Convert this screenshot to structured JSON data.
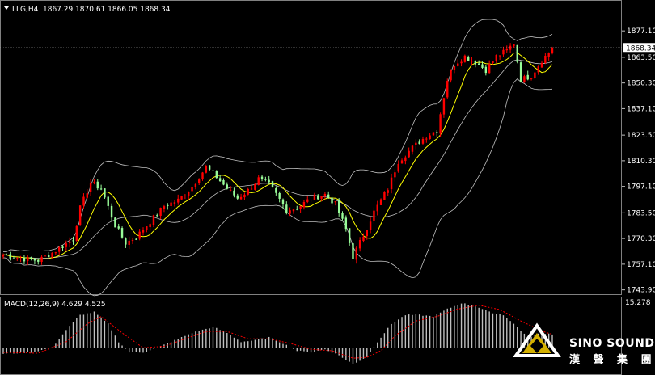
{
  "chart_data": [
    {
      "type": "candlestick",
      "title": "LLG,H4",
      "ohlc_readout": "1867.29 1870.61 1866.05 1868.34",
      "price_label": "1868.34",
      "yticks": [
        "1877.10",
        "1863.50",
        "1850.30",
        "1837.10",
        "1823.50",
        "1810.30",
        "1797.10",
        "1783.50",
        "1770.30",
        "1757.10",
        "1743.90"
      ],
      "ylim": [
        1742.5,
        1880.5
      ],
      "grid": false,
      "colors": {
        "bull": "#ff0000",
        "bear": "#98fb98",
        "bands": "#c0c0c0",
        "ma": "#ffff00",
        "price_line": "#c0c0c0"
      },
      "indicators": [
        "Bollinger Bands",
        "Moving Average"
      ],
      "anchors": [
        [
          0,
          1762
        ],
        [
          5,
          1760
        ],
        [
          10,
          1759
        ],
        [
          15,
          1764
        ],
        [
          20,
          1770
        ],
        [
          22,
          1786
        ],
        [
          25,
          1799
        ],
        [
          28,
          1796
        ],
        [
          32,
          1777
        ],
        [
          35,
          1768
        ],
        [
          38,
          1771
        ],
        [
          42,
          1779
        ],
        [
          46,
          1787
        ],
        [
          50,
          1790
        ],
        [
          54,
          1797
        ],
        [
          58,
          1807
        ],
        [
          61,
          1802
        ],
        [
          64,
          1796
        ],
        [
          67,
          1791
        ],
        [
          70,
          1795
        ],
        [
          73,
          1801
        ],
        [
          76,
          1798
        ],
        [
          78,
          1793
        ],
        [
          81,
          1785
        ],
        [
          84,
          1786
        ],
        [
          88,
          1791
        ],
        [
          92,
          1793
        ],
        [
          95,
          1788
        ],
        [
          98,
          1775
        ],
        [
          100,
          1761
        ],
        [
          103,
          1772
        ],
        [
          106,
          1784
        ],
        [
          110,
          1796
        ],
        [
          113,
          1810
        ],
        [
          117,
          1817
        ],
        [
          121,
          1823
        ],
        [
          124,
          1826
        ],
        [
          127,
          1852
        ],
        [
          129,
          1860
        ],
        [
          132,
          1864
        ],
        [
          135,
          1861
        ],
        [
          138,
          1857
        ],
        [
          141,
          1864
        ],
        [
          144,
          1867
        ],
        [
          146,
          1871
        ],
        [
          148,
          1852
        ],
        [
          151,
          1854
        ],
        [
          154,
          1862
        ],
        [
          157,
          1868
        ]
      ],
      "candle_count": 158
    },
    {
      "type": "bar",
      "title": "MACD(12,26,9) 4.629 4.525",
      "yticks_visible": [
        "15.278"
      ],
      "ylim": [
        -7.5,
        15.278
      ],
      "colors": {
        "histogram": "#c0c0c0",
        "signal": "#ff0000"
      },
      "anchors": [
        [
          0,
          -2
        ],
        [
          8,
          -1.5
        ],
        [
          14,
          0
        ],
        [
          18,
          6
        ],
        [
          22,
          11
        ],
        [
          26,
          12
        ],
        [
          30,
          8
        ],
        [
          33,
          2
        ],
        [
          36,
          -1.5
        ],
        [
          40,
          -1.5
        ],
        [
          44,
          0
        ],
        [
          48,
          2
        ],
        [
          54,
          5
        ],
        [
          60,
          7
        ],
        [
          64,
          5
        ],
        [
          68,
          2
        ],
        [
          72,
          2.5
        ],
        [
          76,
          3.5
        ],
        [
          80,
          1.5
        ],
        [
          84,
          -1
        ],
        [
          88,
          -1.5
        ],
        [
          92,
          -0.5
        ],
        [
          96,
          -2.5
        ],
        [
          100,
          -5.5
        ],
        [
          104,
          -3
        ],
        [
          107,
          2
        ],
        [
          111,
          8
        ],
        [
          115,
          11
        ],
        [
          119,
          11
        ],
        [
          123,
          10.5
        ],
        [
          127,
          13
        ],
        [
          131,
          15
        ],
        [
          135,
          14
        ],
        [
          139,
          12
        ],
        [
          143,
          11
        ],
        [
          147,
          7
        ],
        [
          150,
          3.5
        ],
        [
          154,
          5
        ],
        [
          157,
          4.6
        ]
      ],
      "signal_anchors": [
        [
          0,
          -1.5
        ],
        [
          10,
          -1.8
        ],
        [
          18,
          2
        ],
        [
          24,
          8
        ],
        [
          28,
          10.5
        ],
        [
          34,
          5
        ],
        [
          40,
          0
        ],
        [
          46,
          0.5
        ],
        [
          52,
          3
        ],
        [
          58,
          5.5
        ],
        [
          64,
          5.5
        ],
        [
          70,
          3
        ],
        [
          76,
          3
        ],
        [
          82,
          1.5
        ],
        [
          88,
          -0.5
        ],
        [
          94,
          -1
        ],
        [
          100,
          -3.5
        ],
        [
          104,
          -3.2
        ],
        [
          108,
          -1
        ],
        [
          112,
          4
        ],
        [
          118,
          9
        ],
        [
          124,
          10.5
        ],
        [
          130,
          13
        ],
        [
          136,
          14.3
        ],
        [
          142,
          12.8
        ],
        [
          148,
          9
        ],
        [
          154,
          5.6
        ],
        [
          157,
          4.5
        ]
      ]
    }
  ],
  "watermark": {
    "brand_en": "SINO SOUND",
    "brand_cn": "漢 聲 集 團"
  }
}
